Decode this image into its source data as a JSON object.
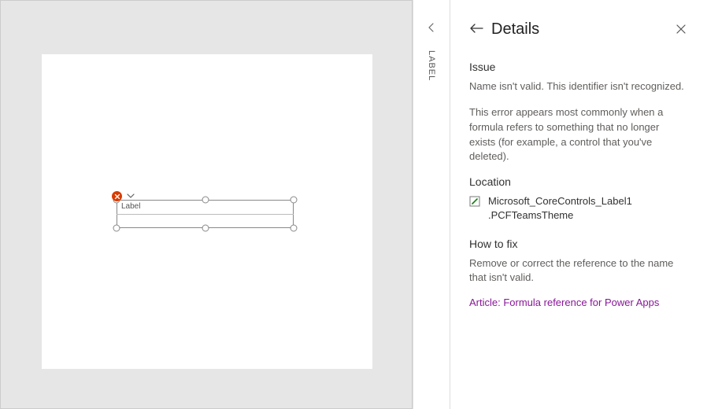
{
  "canvas": {
    "control_label": "Label",
    "side_tab_label": "LABEL"
  },
  "details": {
    "title": "Details",
    "issue_heading": "Issue",
    "issue_summary": "Name isn't valid. This identifier isn't recognized.",
    "issue_explain": "This error appears most commonly when a formula refers to something that no longer exists (for example, a control that you've deleted).",
    "location_heading": "Location",
    "location_control": "Microsoft_CoreControls_Label1",
    "location_property": ".PCFTeamsTheme",
    "fix_heading": "How to fix",
    "fix_text": "Remove or correct the reference to the name that isn't valid.",
    "article_link": "Article: Formula reference for Power Apps"
  }
}
